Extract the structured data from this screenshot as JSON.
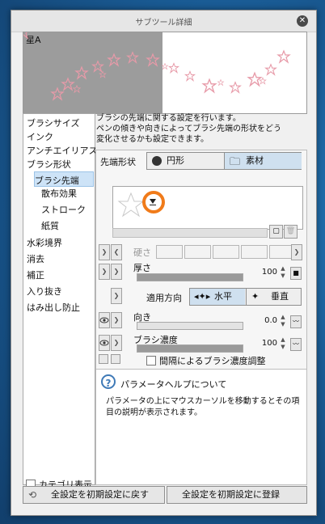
{
  "window": {
    "title": "サブツール詳細",
    "close_glyph": "✕"
  },
  "preview": {
    "label": "星A"
  },
  "categories": [
    {
      "label": "ブラシサイズ"
    },
    {
      "label": "インク"
    },
    {
      "label": "アンチエイリアス"
    },
    {
      "label": "ブラシ形状"
    },
    {
      "label": "ブラシ先端"
    },
    {
      "label": "散布効果"
    },
    {
      "label": "ストローク"
    },
    {
      "label": "紙質"
    },
    {
      "label": "水彩境界"
    },
    {
      "label": "消去"
    },
    {
      "label": "補正"
    },
    {
      "label": "入り抜き"
    },
    {
      "label": "はみ出し防止"
    }
  ],
  "category_toggle": "カテゴリ表示",
  "description": {
    "line1": "ブラシの先端に関する設定を行います。",
    "line2": "ペンの傾きや向きによってブラシ先端の形状をどう",
    "line3": "変化させるかも設定できます。"
  },
  "tip_shape": {
    "label": "先端形状",
    "opt_circle": "円形",
    "opt_material": "素材",
    "selected": "素材"
  },
  "hardness": {
    "label": "硬さ"
  },
  "thickness": {
    "label": "厚さ",
    "value": "100"
  },
  "direction_apply": {
    "label": "適用方向",
    "opt_h": "水平",
    "opt_v": "垂直",
    "selected": "水平"
  },
  "angle": {
    "label": "向き",
    "value": "0.0"
  },
  "brush_density": {
    "label": "ブラシ濃度",
    "value": "100"
  },
  "interval_density": {
    "label": "間隔によるブラシ濃度調整"
  },
  "help": {
    "title": "パラメータヘルプについて",
    "line1": "パラメータの上にマウスカーソルを移動するとその項",
    "line2": "目の説明が表示されます。"
  },
  "buttons": {
    "reset": "全設定を初期設定に戻す",
    "register": "全設定を初期設定に登録"
  },
  "colors": {
    "accent_ring": "#f07b1a",
    "selection": "#cde3f7",
    "star_pink": "#e79aa8"
  }
}
